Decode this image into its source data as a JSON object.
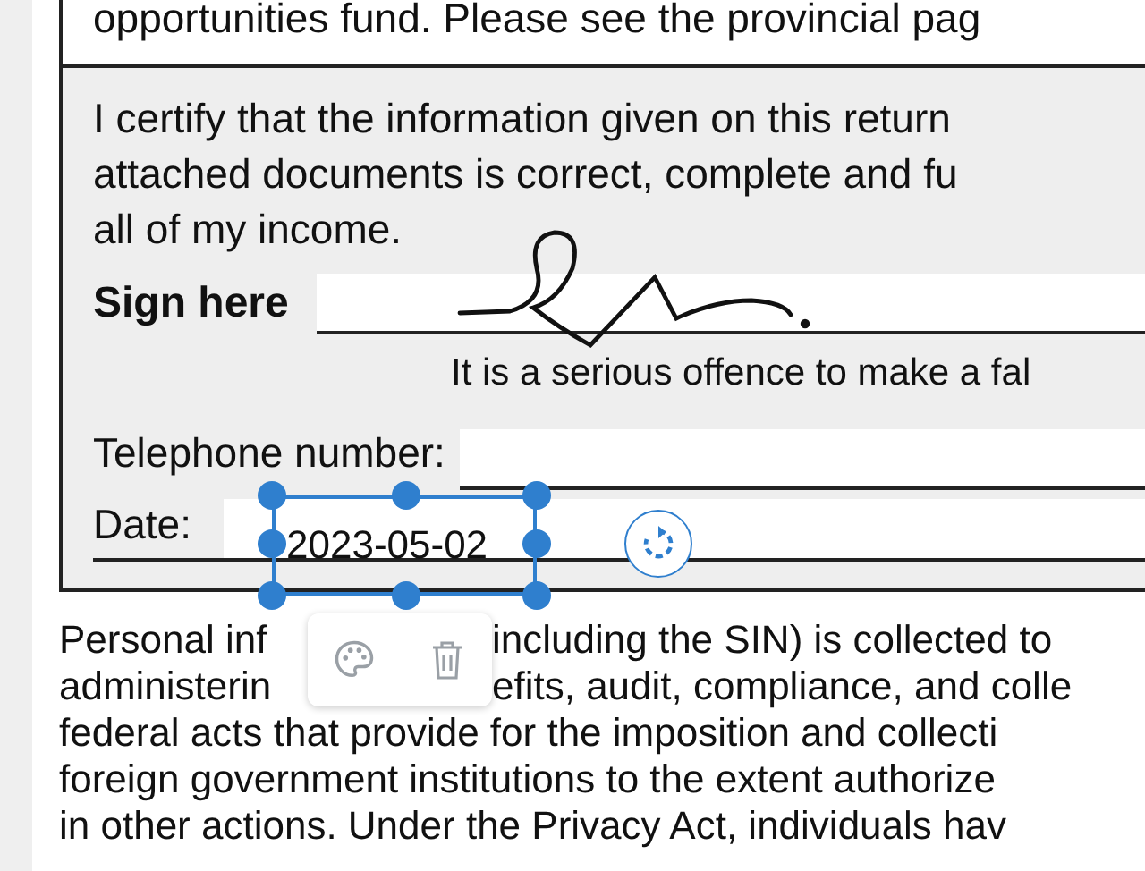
{
  "document": {
    "top_line": "opportunities fund. Please see the provincial pag",
    "certification": {
      "lines": [
        "I certify that the information given on this return",
        "attached documents is correct, complete and fu",
        "all of my income."
      ],
      "sign_label": "Sign here",
      "warning": "It is a serious offence to make a fal",
      "phone_label": "Telephone number:",
      "date_label": "Date:",
      "date_field": {
        "value": "2023-05-02",
        "selected": true
      }
    },
    "privacy_lines": [
      {
        "text": "Personal inf",
        "after": "including the SIN) is collected to"
      },
      {
        "text": "administerin",
        "after": "efits, audit, compliance, and colle"
      },
      {
        "text": "federal acts that provide for the imposition and collecti"
      },
      {
        "text": "foreign government institutions to the extent authorize"
      },
      {
        "text": "in other actions. Under the Privacy Act, individuals hav"
      }
    ]
  }
}
